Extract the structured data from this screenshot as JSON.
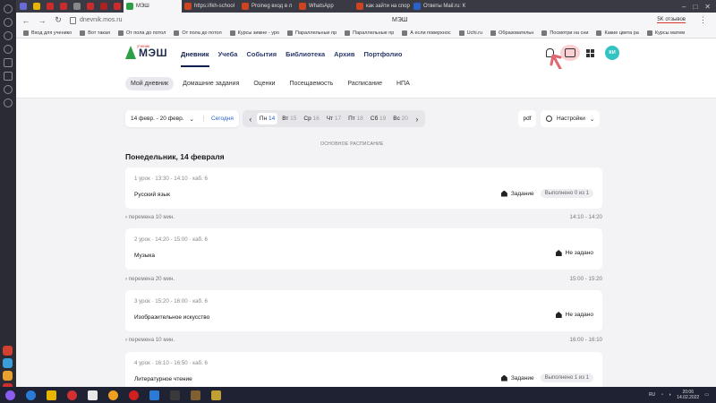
{
  "browser": {
    "tabs": [
      {
        "label": "",
        "color": "#6b6bd6"
      },
      {
        "label": "",
        "color": "#e8b400"
      },
      {
        "label": "",
        "color": "#cc2b2b"
      },
      {
        "label": "",
        "color": "#cc2b2b"
      },
      {
        "label": "",
        "color": "#888888"
      },
      {
        "label": "",
        "color": "#cc2b2b"
      },
      {
        "label": "",
        "color": "#aa2222"
      },
      {
        "label": "",
        "color": "#cc2b2b"
      },
      {
        "label": "МЭШ",
        "color": "#2e9e47"
      },
      {
        "label": "https://lkh-school",
        "color": "#cc4422"
      },
      {
        "label": "Proineg вход в л",
        "color": "#cc4422"
      },
      {
        "label": "WhatsApp",
        "color": "#cc4422"
      },
      {
        "label": "как зайти на спор",
        "color": "#cc4422"
      },
      {
        "label": "Ответы Mail.ru: К",
        "color": "#2b62c9"
      }
    ],
    "url": "dnevnik.mos.ru",
    "page_title": "МЭШ",
    "feedback_label": "5K отзывов",
    "bookmarks": [
      "Вход для ученико",
      "Вот такая",
      "От пола до потол",
      "От пола до потол",
      "Курсы зимне - уро",
      "Параллельные пр",
      "Параллельные пр",
      "А если поверхнос",
      "Uchi.ru",
      "Образовательн",
      "Посмотри на сни",
      "Какие цвета ра",
      "Курсы матем"
    ]
  },
  "site": {
    "logo_small": "ученик",
    "logo_big": "МЭШ",
    "nav": [
      "Дневник",
      "Учеба",
      "События",
      "Библиотека",
      "Архив",
      "Портфолио"
    ],
    "avatar_initials": "КИ",
    "subnav": [
      "Мой дневник",
      "Домашние задания",
      "Оценки",
      "Посещаемость",
      "Расписание",
      "НПА"
    ]
  },
  "toolbar": {
    "date_range": "14 февр. - 20 февр.",
    "today_label": "Сегодня",
    "days": [
      {
        "name": "Пн",
        "num": "14"
      },
      {
        "name": "Вт",
        "num": "15"
      },
      {
        "name": "Ср",
        "num": "16"
      },
      {
        "name": "Чт",
        "num": "17"
      },
      {
        "name": "Пт",
        "num": "18"
      },
      {
        "name": "Сб",
        "num": "19"
      },
      {
        "name": "Вс",
        "num": "20"
      }
    ],
    "pdf_label": "pdf",
    "settings_label": "Настройки"
  },
  "schedule": {
    "label": "ОСНОВНОЕ РАСПИСАНИЕ",
    "day_title": "Понедельник, 14 февраля",
    "lessons": [
      {
        "meta": "1 урок · 13:30 - 14:10 · каб. 6",
        "name": "Русский язык",
        "hw": "Задание",
        "done": "Выполнено 0 из 1"
      },
      {
        "meta": "2 урок · 14:20 - 15:00 · каб. 6",
        "name": "Музыка",
        "hw": "Не задано",
        "done": ""
      },
      {
        "meta": "3 урок · 15:20 - 16:00 · каб. 6",
        "name": "Изобразительное искусство",
        "hw": "Не задано",
        "done": ""
      },
      {
        "meta": "4 урок · 16:10 - 16:50 · каб. 6",
        "name": "Литературное чтение",
        "hw": "Задание",
        "done": "Выполнено 1 из 1"
      }
    ],
    "breaks": [
      {
        "label": "перемена 10 мин.",
        "time": "14:10 - 14:20"
      },
      {
        "label": "перемена 20 мин.",
        "time": "15:00 - 15:20"
      },
      {
        "label": "перемена 10 мин.",
        "time": "16:00 - 16:10"
      }
    ]
  },
  "taskbar": {
    "lang": "RU",
    "time": "20:06",
    "date": "14.02.2022"
  }
}
